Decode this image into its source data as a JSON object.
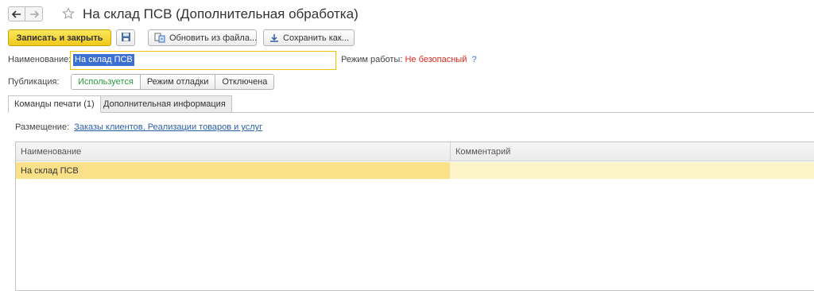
{
  "window": {
    "title": "На склад ПСВ (Дополнительная обработка)"
  },
  "toolbar": {
    "save_close_label": "Записать и закрыть",
    "update_from_file_label": "Обновить из файла...",
    "save_as_label": "Сохранить как..."
  },
  "form": {
    "name_label": "Наименование:",
    "name_value": "На склад ПСВ",
    "mode_label": "Режим работы:",
    "mode_value": "Не безопасный",
    "help_mark": "?",
    "publication_label": "Публикация:",
    "publication_options": [
      "Используется",
      "Режим отладки",
      "Отключена"
    ],
    "publication_selected": "Используется"
  },
  "tabs": [
    {
      "label": "Команды печати (1)",
      "active": true
    },
    {
      "label": "Дополнительная информация",
      "active": false
    }
  ],
  "placement": {
    "label": "Размещение:",
    "link": "Заказы клиентов, Реализации товаров и услуг"
  },
  "table": {
    "columns": [
      "Наименование",
      "Комментарий"
    ],
    "rows": [
      {
        "name": "На склад ПСВ",
        "comment": ""
      }
    ]
  },
  "colors": {
    "accent_yellow": "#f0c81a",
    "selection_blue": "#3b6fd1",
    "danger_red": "#e0281d",
    "active_green": "#2b9a3e",
    "row_selected": "#fbe08a"
  }
}
